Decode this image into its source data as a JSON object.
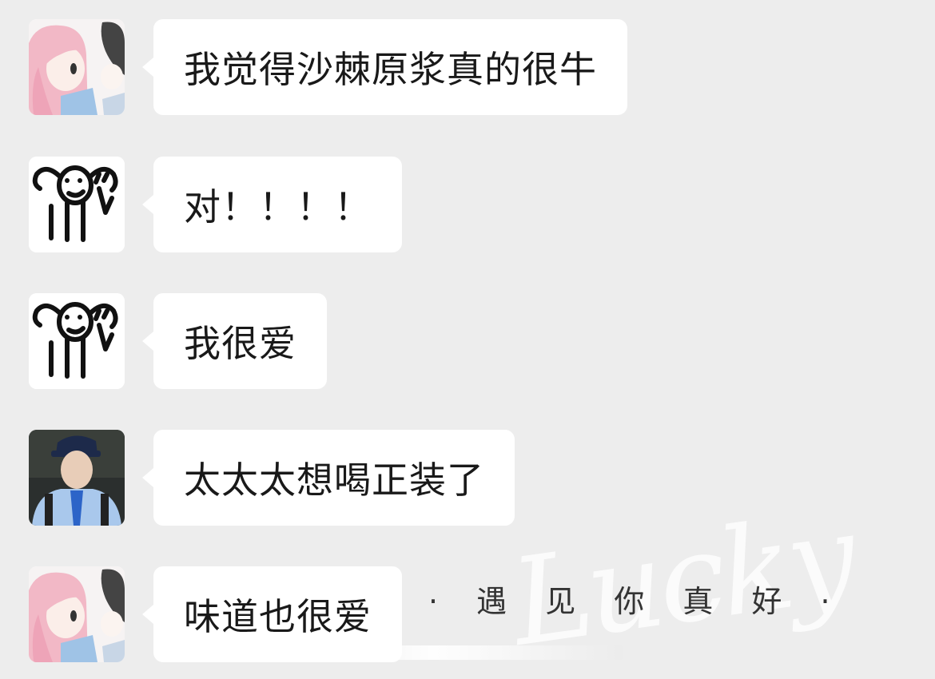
{
  "messages": [
    {
      "avatar": "anime-girl-avatar",
      "text": "我觉得沙棘原浆真的很牛"
    },
    {
      "avatar": "stick-figure-avatar",
      "text": "对！！！！"
    },
    {
      "avatar": "stick-figure-avatar",
      "text": "我很爱"
    },
    {
      "avatar": "boy-photo-avatar",
      "text": "太太太想喝正装了"
    },
    {
      "avatar": "anime-girl-avatar",
      "text": "味道也很爱"
    }
  ],
  "watermark": {
    "script_text": "Lucky",
    "caption": "· 遇 见 你 真 好 ·"
  },
  "colors": {
    "background": "#ededed",
    "bubble": "#ffffff",
    "text": "#191919"
  }
}
